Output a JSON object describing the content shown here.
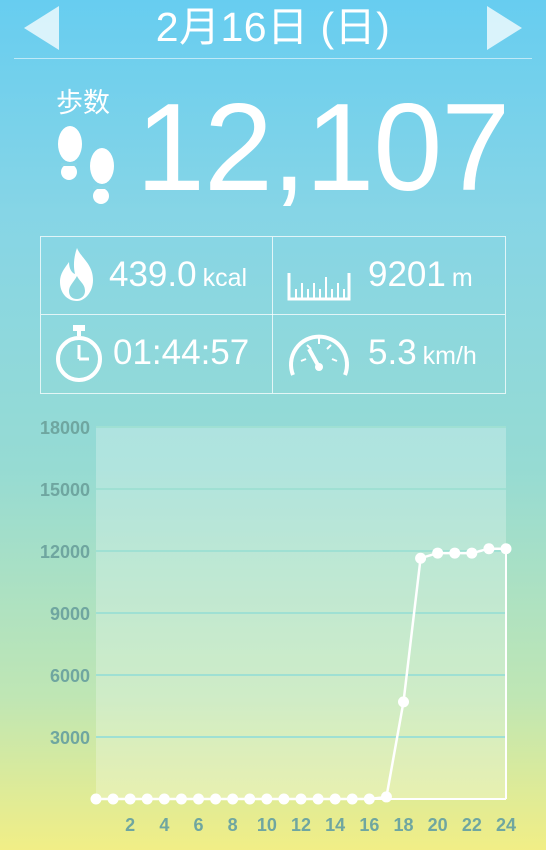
{
  "header": {
    "date": "2月16日 (日)",
    "prev_icon": "triangle-left-icon",
    "next_icon": "triangle-right-icon"
  },
  "steps": {
    "label": "歩数",
    "value": "12,107",
    "icon": "footprints-icon"
  },
  "stats": {
    "calories": {
      "value": "439.0",
      "unit": "kcal",
      "icon": "flame-icon"
    },
    "distance": {
      "value": "9201",
      "unit": "m",
      "icon": "ruler-icon"
    },
    "time": {
      "value": "01:44:57",
      "unit": "",
      "icon": "stopwatch-icon"
    },
    "speed": {
      "value": "5.3",
      "unit": "km/h",
      "icon": "speedometer-icon"
    }
  },
  "chart_data": {
    "type": "line",
    "x": [
      1,
      2,
      3,
      4,
      5,
      6,
      7,
      8,
      9,
      10,
      11,
      12,
      13,
      14,
      15,
      16,
      17,
      18,
      19,
      20,
      21,
      22,
      23,
      24
    ],
    "values": [
      0,
      0,
      0,
      0,
      0,
      0,
      0,
      0,
      0,
      0,
      0,
      0,
      0,
      0,
      0,
      0,
      100,
      4700,
      11650,
      11900,
      11900,
      11900,
      12107,
      12107
    ],
    "x_tick_labels": [
      "2",
      "4",
      "6",
      "8",
      "10",
      "12",
      "14",
      "16",
      "18",
      "20",
      "22",
      "24"
    ],
    "y_tick_labels": [
      "3000",
      "6000",
      "9000",
      "12000",
      "15000",
      "18000"
    ],
    "ylim": [
      0,
      18000
    ],
    "xlim": [
      0,
      24
    ],
    "grid": true,
    "title": "",
    "xlabel": "",
    "ylabel": ""
  }
}
